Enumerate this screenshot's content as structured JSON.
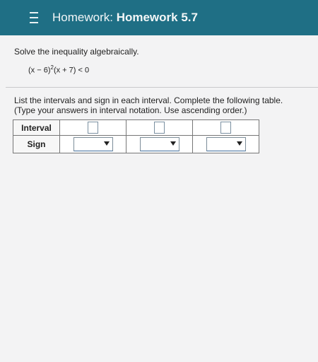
{
  "header": {
    "title_prefix": "Homework:",
    "title_name": "Homework 5.7"
  },
  "question": {
    "instruction": "Solve the inequality algebraically.",
    "formula_part1": "(x − 6)",
    "formula_exp": "2",
    "formula_part2": "(x + 7) < 0",
    "table_instruction": "List the intervals and sign in each interval. Complete the following table.",
    "table_hint": "(Type your answers in interval notation. Use ascending order.)"
  },
  "table": {
    "row_labels": [
      "Interval",
      "Sign"
    ],
    "interval_values": [
      "",
      "",
      ""
    ],
    "sign_values": [
      "",
      "",
      ""
    ]
  }
}
